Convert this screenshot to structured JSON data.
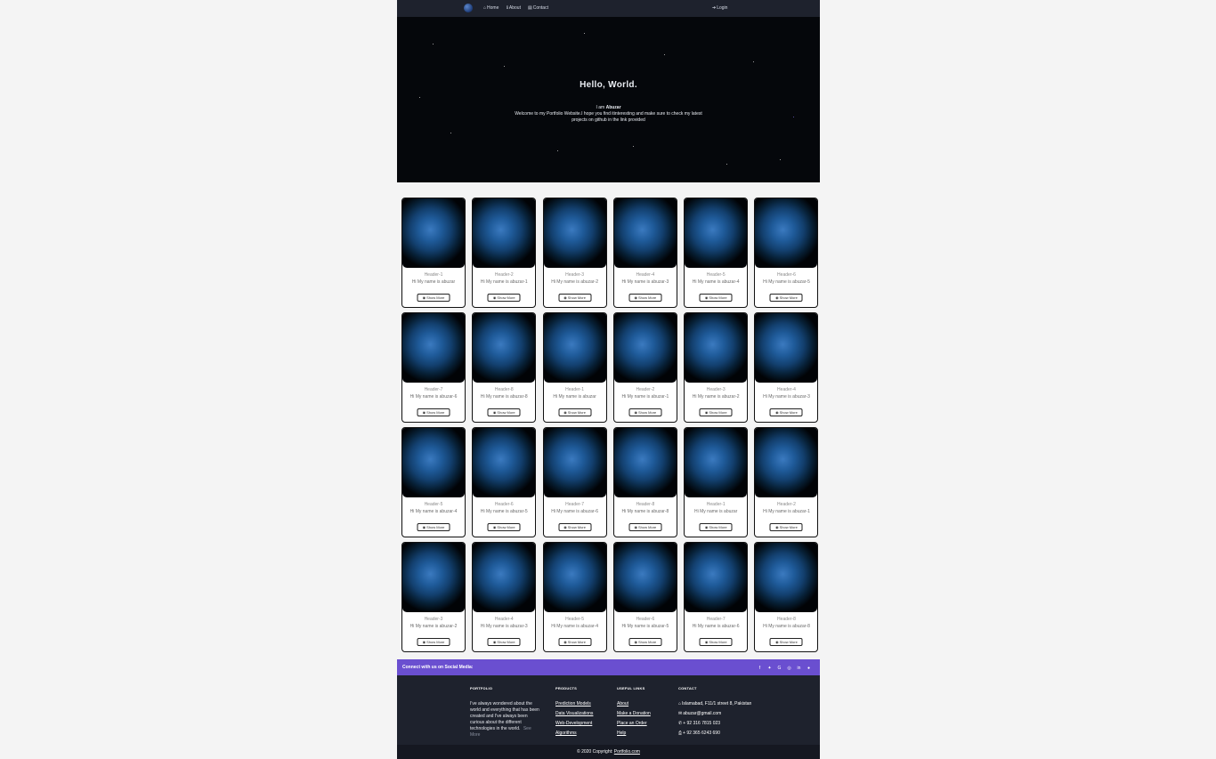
{
  "navbar": {
    "home": "Home",
    "about": "About",
    "contact": "Contact",
    "login": "Login"
  },
  "hero": {
    "title": "Hello, World.",
    "intro_prefix": "I am",
    "name": "Abuzar",
    "text": "Welcome to my Portfolio Website.I hope you find itinteresting and make sure to check my latest projects on github in the link provided"
  },
  "cards": [
    {
      "header": "Header-1",
      "desc": "Hi My name is abuzar",
      "button": "Show More"
    },
    {
      "header": "Header-2",
      "desc": "Hi My name is abuzar-1",
      "button": "Show More"
    },
    {
      "header": "Header-3",
      "desc": "Hi My name is abuzar-2",
      "button": "Show More"
    },
    {
      "header": "Header-4",
      "desc": "Hi My name is abuzar-3",
      "button": "Show More"
    },
    {
      "header": "Header-5",
      "desc": "Hi My name is abuzar-4",
      "button": "Show More"
    },
    {
      "header": "Header-6",
      "desc": "Hi My name is abuzar-5",
      "button": "Show More"
    },
    {
      "header": "Header-7",
      "desc": "Hi My name is abuzar-6",
      "button": "Show More"
    },
    {
      "header": "Header-8",
      "desc": "Hi My name is abuzar-8",
      "button": "Show More"
    },
    {
      "header": "Header-1",
      "desc": "Hi My name is abuzar",
      "button": "Show More"
    },
    {
      "header": "Header-2",
      "desc": "Hi My name is abuzar-1",
      "button": "Show More"
    },
    {
      "header": "Header-3",
      "desc": "Hi My name is abuzar-2",
      "button": "Show More"
    },
    {
      "header": "Header-4",
      "desc": "Hi My name is abuzar-3",
      "button": "Show More"
    },
    {
      "header": "Header-5",
      "desc": "Hi My name is abuzar-4",
      "button": "Show More"
    },
    {
      "header": "Header-6",
      "desc": "Hi My name is abuzar-5",
      "button": "Show More"
    },
    {
      "header": "Header-7",
      "desc": "Hi My name is abuzar-6",
      "button": "Show More"
    },
    {
      "header": "Header-8",
      "desc": "Hi My name is abuzar-8",
      "button": "Show More"
    },
    {
      "header": "Header-1",
      "desc": "Hi My name is abuzar",
      "button": "Show More"
    },
    {
      "header": "Header-2",
      "desc": "Hi My name is abuzar-1",
      "button": "Show More"
    },
    {
      "header": "Header-3",
      "desc": "Hi My name is abuzar-2",
      "button": "Show More"
    },
    {
      "header": "Header-4",
      "desc": "Hi My name is abuzar-3",
      "button": "Show More"
    },
    {
      "header": "Header-5",
      "desc": "Hi My name is abuzar-4",
      "button": "Show More"
    },
    {
      "header": "Header-6",
      "desc": "Hi My name is abuzar-5",
      "button": "Show More"
    },
    {
      "header": "Header-7",
      "desc": "Hi My name is abuzar-6",
      "button": "Show More"
    },
    {
      "header": "Header-8",
      "desc": "Hi My name is abuzar-8",
      "button": "Show More"
    }
  ],
  "social": {
    "text": "Connect with us on Social Media:",
    "icons": [
      "facebook-icon",
      "twitter-icon",
      "google-icon",
      "instagram-icon",
      "linkedin-icon",
      "github-icon"
    ]
  },
  "footer": {
    "portfolio": {
      "heading": "PORTFOLIO",
      "text": "I've always wondered about the world and everything that has been created and I've always been curious about the different technologies in the world.",
      "see_more": "See More"
    },
    "products": {
      "heading": "PRODUCTS",
      "links": [
        "Prediction Models",
        "Data Visualizations",
        "Web-Development",
        "Algorithms"
      ]
    },
    "useful_links": {
      "heading": "USEFUL LINKS",
      "links": [
        "About",
        "Make a Donation",
        "Place an Order",
        "Help"
      ]
    },
    "contact": {
      "heading": "CONTACT",
      "address": "Islamabad, F11/1 street 8, Pakistan",
      "email": "abuzar@gmail.com",
      "phone": "+ 92 316 7815 023",
      "fax": "+ 92 365 6243 690"
    }
  },
  "copyright": {
    "prefix": "© 2020 Copyright:",
    "link": "Portfolio.com"
  },
  "colors": {
    "navbar_bg": "#1e222d",
    "hero_bg": "#05070b",
    "social_bar_bg": "#6a4fd0",
    "footer_bg": "#1e222d",
    "copyright_bg": "#151821"
  }
}
